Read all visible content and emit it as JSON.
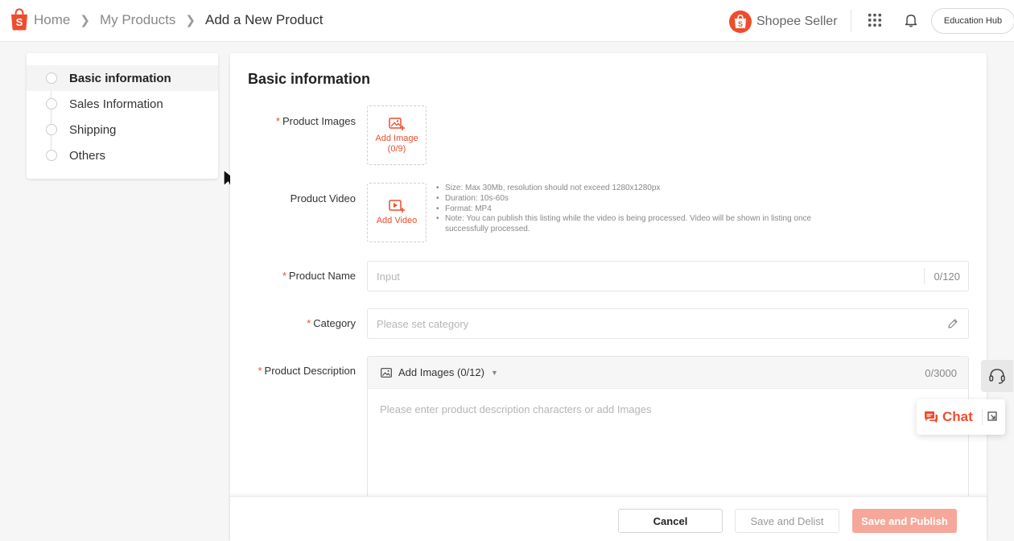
{
  "breadcrumb": {
    "items": [
      "Home",
      "My Products",
      "Add a New Product"
    ]
  },
  "header": {
    "brand": "Shopee Seller",
    "education_hub": "Education Hub"
  },
  "sidebar": {
    "items": [
      {
        "label": "Basic information",
        "active": true
      },
      {
        "label": "Sales Information",
        "active": false
      },
      {
        "label": "Shipping",
        "active": false
      },
      {
        "label": "Others",
        "active": false
      }
    ]
  },
  "form": {
    "section_title": "Basic information",
    "product_images": {
      "label": "Product Images",
      "add_text": "Add Image",
      "count": "(0/9)"
    },
    "product_video": {
      "label": "Product Video",
      "add_text": "Add Video",
      "notes": [
        "Size: Max 30Mb, resolution should not exceed 1280x1280px",
        "Duration: 10s-60s",
        "Format: MP4",
        "Note: You can publish this listing while the video is being processed. Video will be shown in listing once successfully processed."
      ]
    },
    "product_name": {
      "label": "Product Name",
      "placeholder": "Input",
      "counter": "0/120"
    },
    "category": {
      "label": "Category",
      "placeholder": "Please set category"
    },
    "product_description": {
      "label": "Product Description",
      "add_images": "Add Images (0/12)",
      "counter": "0/3000",
      "placeholder": "Please enter product description characters or add Images"
    }
  },
  "footer": {
    "cancel": "Cancel",
    "save_delist": "Save and Delist",
    "save_publish": "Save and Publish"
  },
  "chat": {
    "label": "Chat"
  },
  "colors": {
    "brand": "#ee4d2d",
    "publish_disabled": "#f5a89a"
  },
  "icons": [
    "shopee-bag-icon",
    "chevron-right-icon",
    "apps-grid-icon",
    "bell-icon",
    "image-add-icon",
    "video-add-icon",
    "pencil-icon",
    "image-icon",
    "caret-down-icon",
    "headset-icon",
    "chat-bubble-icon",
    "expand-icon",
    "mouse-cursor-icon"
  ]
}
